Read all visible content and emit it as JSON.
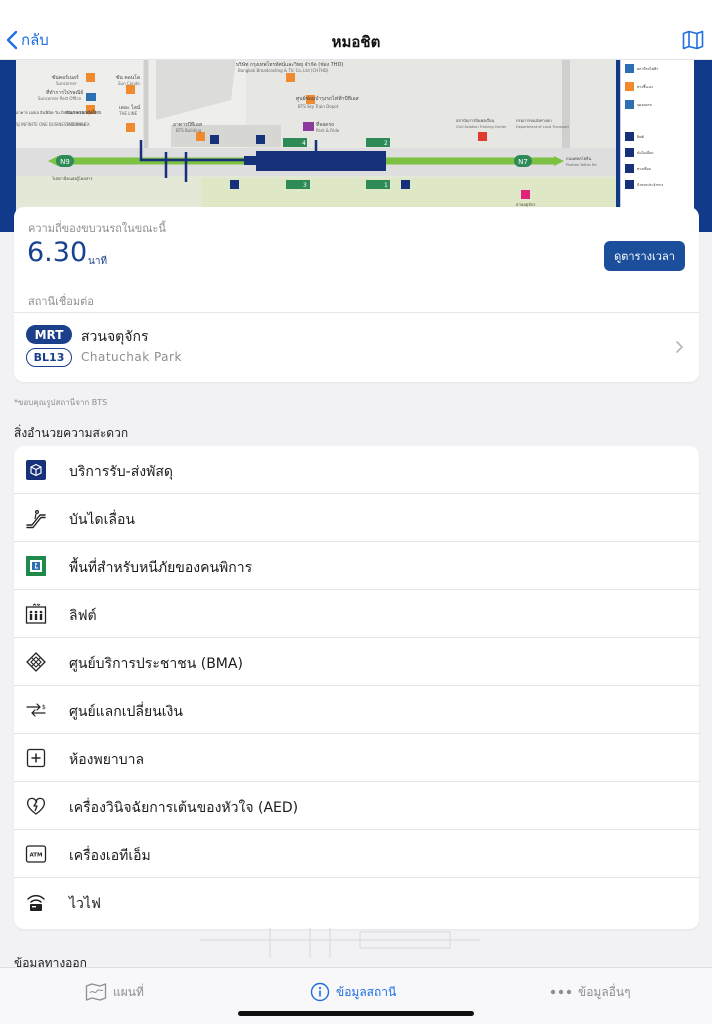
{
  "nav": {
    "back_label": "กลับ",
    "title": "หมอชิต"
  },
  "map": {
    "labels": [
      "บริษัท กรุงเทพโทรทัศน์และวิทยุ จำกัด (ช่อง 7HD)",
      "Bangkok Broadcasting & TV. Co.,Ltd (CH7HD)",
      "ซันคอร์เนอร์",
      "Suncorner",
      "ที่ทำการไปรษณีย์",
      "Suncorner Post Office",
      "ซัน คอนโด",
      "Sun Condo",
      "อาคาร เอสเจ อินฟินิท วัน บิสซิเนส คอมเพล็กซ์",
      "SJ INFINITE ONE BUSINESS COMPLEX",
      "ธนาคารกรุงไทย",
      "TMB Bank",
      "เดอะ ไลน์",
      "THE LINE",
      "อาคารบีทีเอส",
      "BTS Building",
      "ศูนย์ซ่อมบำรุงรถไฟฟ้าบีทีเอส",
      "BTS Sky Train Depot",
      "ที่จอดรถ",
      "Park & Ride",
      "สถาบันการบินพลเรือน",
      "Civil Aviation Training Center",
      "กรมการขนส่งทางบก",
      "Department of Land Transport",
      "ถนนพหลโยธิน",
      "Phahon Yothin Rd",
      "สวนจตุจักร",
      "ไปสถานีขนส่งผู้โดยสาร"
    ],
    "station_codes": {
      "left": "N9",
      "right": "N7"
    },
    "exits": [
      "1",
      "2",
      "3",
      "4"
    ],
    "legend_items": [
      "สถานีรถไฟฟ้า",
      "ทางขึ้น-ลง",
      "จุดจอดรถ",
      "ลิฟต์",
      "บันไดเลื่อน",
      "ทางเชื่อม",
      "ป้ายรถประจำทาง"
    ]
  },
  "frequency": {
    "label": "ความถี่ของขบวนรถในขณะนี้",
    "value": "6.30",
    "unit": "นาที",
    "timetable_button": "ดูตารางเวลา"
  },
  "connection": {
    "label": "สถานีเชื่อมต่อ",
    "line_badge": "MRT",
    "station_code": "BL13",
    "station_name_th": "สวนจตุจักร",
    "station_name_en": "Chatuchak Park"
  },
  "credit": "*ขอบคุณรูปสถานีจาก BTS",
  "facilities_title": "สิ่งอำนวยความสะดวก",
  "facilities": [
    {
      "label": "บริการรับ-ส่งพัสดุ",
      "icon": "parcel-icon"
    },
    {
      "label": "บันไดเลื่อน",
      "icon": "escalator-icon"
    },
    {
      "label": "พื้นที่สำหรับหนีภัยของคนพิการ",
      "icon": "disabled-refuge-icon"
    },
    {
      "label": "ลิฟต์",
      "icon": "elevator-icon"
    },
    {
      "label": "ศูนย์บริการประชาชน (BMA)",
      "icon": "bma-service-icon"
    },
    {
      "label": "ศูนย์แลกเปลี่ยนเงิน",
      "icon": "currency-exchange-icon"
    },
    {
      "label": "ห้องพยาบาล",
      "icon": "first-aid-icon"
    },
    {
      "label": "เครื่องวินิจฉัยการเต้นของหัวใจ (AED)",
      "icon": "aed-icon"
    },
    {
      "label": "เครื่องเอทีเอ็ม",
      "icon": "atm-icon"
    },
    {
      "label": "ไวไฟ",
      "icon": "wifi-icon"
    }
  ],
  "exits_title": "ข้อมูลทางออก",
  "tabs": [
    {
      "label": "แผนที่",
      "icon": "map-icon"
    },
    {
      "label": "ข้อมูลสถานี",
      "icon": "info-icon"
    },
    {
      "label": "ข้อมูลอื่นๆ",
      "icon": "more-icon"
    }
  ],
  "colors": {
    "accent": "#1f6fe0",
    "primary_blue": "#1b4f9c",
    "mrt_blue": "#1b3f8a",
    "green_line": "#7cc142"
  }
}
